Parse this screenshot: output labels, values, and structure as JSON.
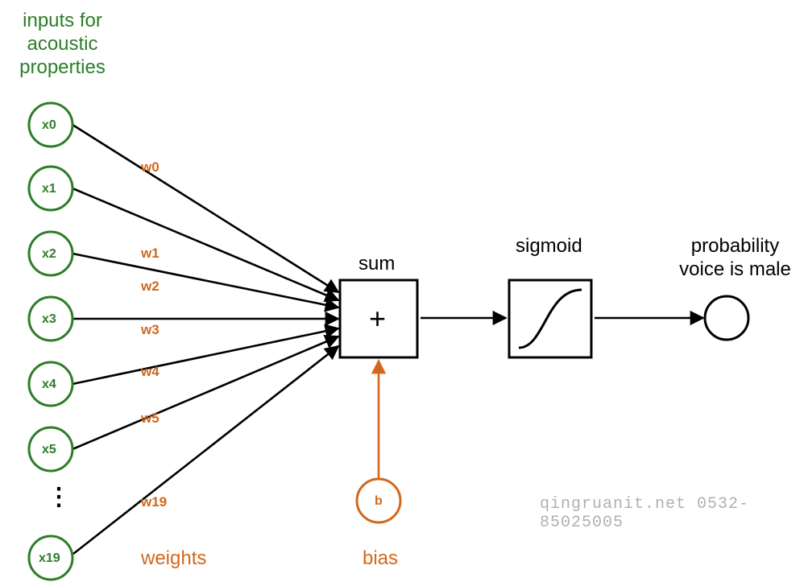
{
  "header": {
    "title": "inputs for\nacoustic\nproperties"
  },
  "inputs": {
    "nodes": [
      "x0",
      "x1",
      "x2",
      "x3",
      "x4",
      "x5",
      "x19"
    ],
    "ellipsis": "⋮"
  },
  "weights": {
    "labels": [
      "w0",
      "w1",
      "w2",
      "w3",
      "w4",
      "w5",
      "w19"
    ],
    "caption": "weights"
  },
  "bias": {
    "node": "b",
    "caption": "bias"
  },
  "sum": {
    "title": "sum",
    "symbol": "+"
  },
  "sigmoid": {
    "title": "sigmoid"
  },
  "output": {
    "title": "probability\nvoice is male"
  },
  "watermark": "qingruanit.net 0532-85025005",
  "colors": {
    "green": "#2c7e28",
    "orange": "#d1681b",
    "black": "#000000"
  }
}
